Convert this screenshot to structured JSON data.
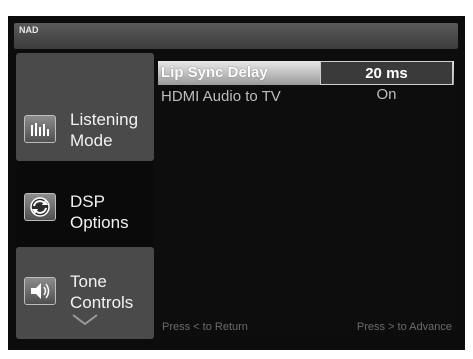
{
  "header": {
    "brand": "NAD"
  },
  "sidebar": {
    "items": [
      {
        "label": "Listening\nMode",
        "icon": "equalizer-bars-icon"
      },
      {
        "label": "DSP\nOptions",
        "icon": "refresh-cycle-icon"
      },
      {
        "label": "Tone\nControls",
        "icon": "speaker-icon"
      }
    ]
  },
  "settings": [
    {
      "label": "Lip Sync Delay",
      "value": "20 ms"
    },
    {
      "label": "HDMI Audio to TV",
      "value": "On"
    }
  ],
  "footer": {
    "left_hint": "Press < to Return",
    "right_hint": "Press > to Advance"
  }
}
